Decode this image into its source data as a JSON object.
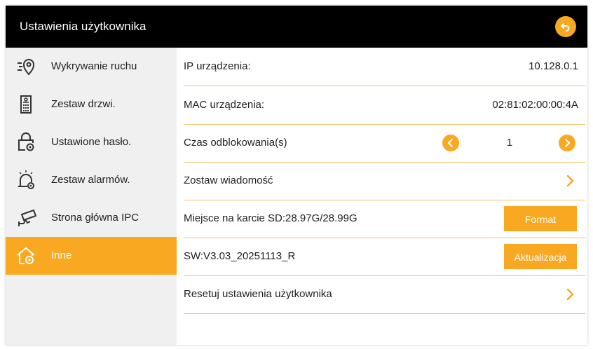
{
  "header": {
    "title": "Ustawienia użytkownika",
    "back_icon": "back-arrow-icon"
  },
  "colors": {
    "accent": "#f9a821",
    "header_bg": "#000000",
    "sidebar_bg": "#f0f0f0",
    "divider": "#f2c46a"
  },
  "sidebar": {
    "items": [
      {
        "label": "Wykrywanie ruchu",
        "icon": "motion-location-icon"
      },
      {
        "label": "Zestaw drzwi.",
        "icon": "door-station-icon"
      },
      {
        "label": "Ustawione hasło.",
        "icon": "lock-gear-icon"
      },
      {
        "label": "Zestaw alarmów.",
        "icon": "alarm-bell-gear-icon"
      },
      {
        "label": "Strona główna IPC",
        "icon": "cctv-camera-icon"
      },
      {
        "label": "Inne",
        "icon": "home-gear-icon",
        "active": true
      }
    ]
  },
  "settings": {
    "ip_label": "IP urządzenia:",
    "ip_value": "10.128.0.1",
    "mac_label": "MAC urządzenia:",
    "mac_value": "02:81:02:00:00:4A",
    "unlock_label": "Czas odblokowania(s)",
    "unlock_value": "1",
    "message_label": "Zostaw wiadomość",
    "sd_label": "Miejsce na karcie SD:28.97G/28.99G",
    "format_button": "Format",
    "sw_label": "SW:V3.03_20251113_R",
    "update_button": "Aktualizacja",
    "reset_label": "Resetuj ustawienia użytkownika"
  }
}
